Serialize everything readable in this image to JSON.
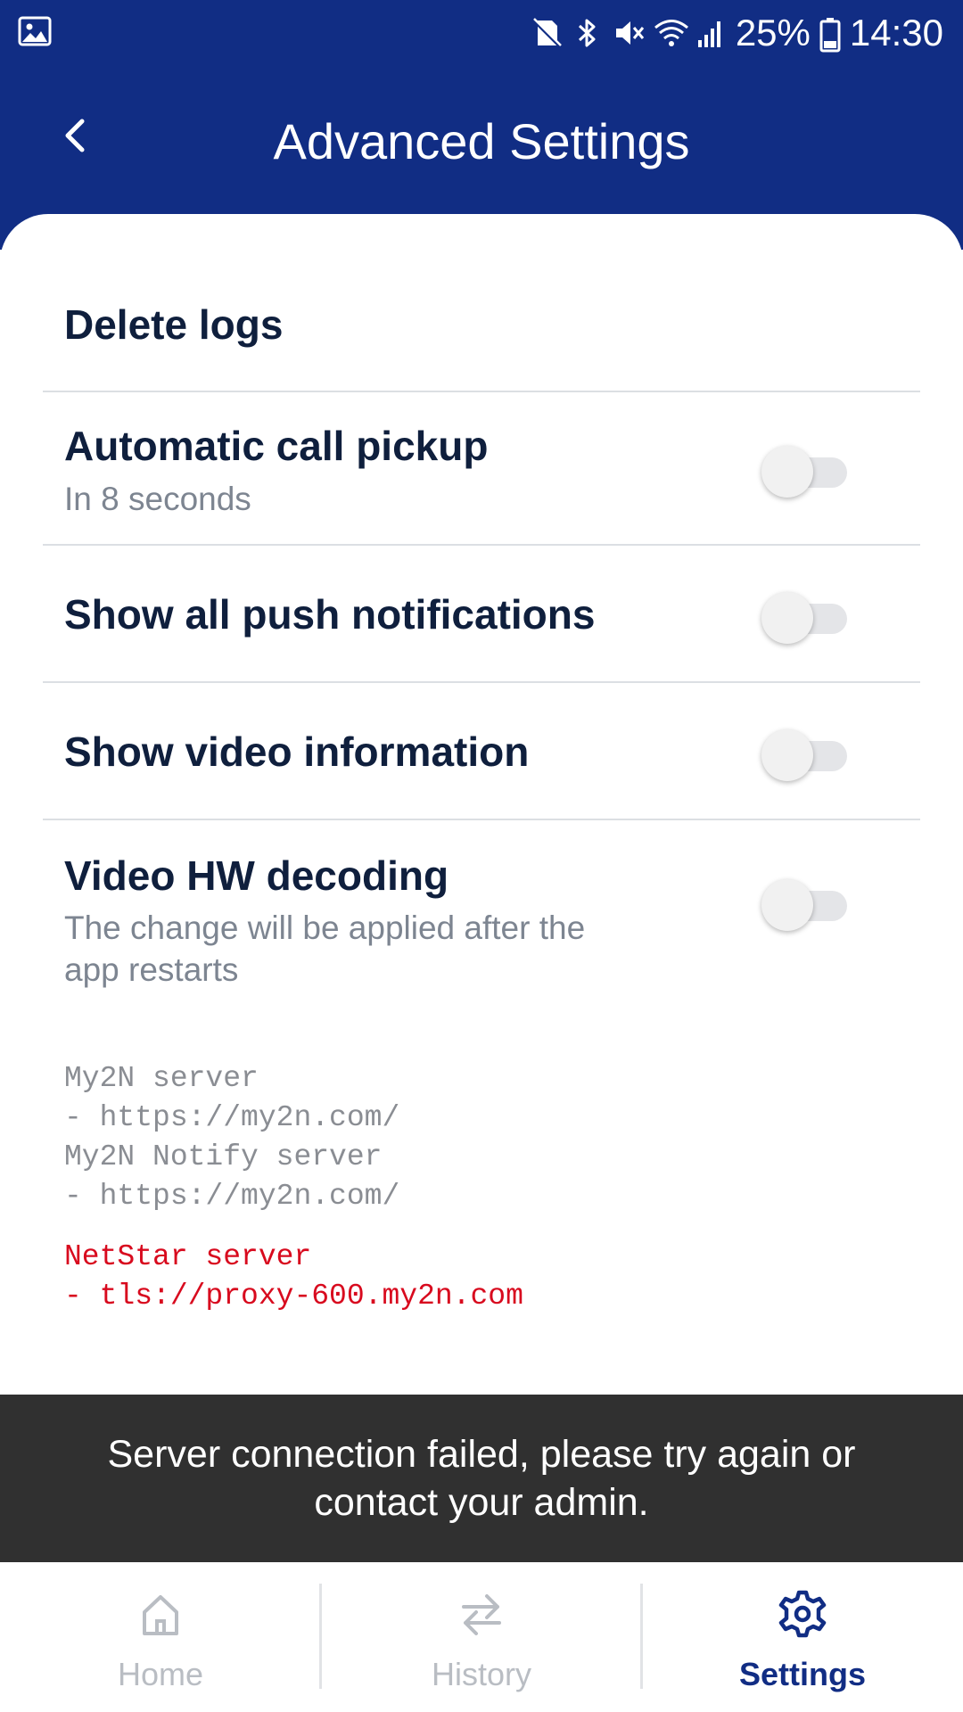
{
  "colors": {
    "header_bg": "#112d84",
    "title_text": "#0f1f3d",
    "subtitle_text": "#7d8591",
    "error_text": "#d80a1e",
    "snackbar_bg": "#303030",
    "nav_active": "#112d84",
    "nav_inactive": "#b9bdc3"
  },
  "status_bar": {
    "battery": "25%",
    "time": "14:30",
    "icons": [
      "gallery-icon",
      "no-sim-icon",
      "bluetooth-icon",
      "mute-icon",
      "wifi-icon",
      "signal-icon",
      "battery-icon"
    ]
  },
  "header": {
    "back_icon": "chevron-left-icon",
    "title": "Advanced Settings"
  },
  "settings": {
    "delete_logs": {
      "title": "Delete logs"
    },
    "auto_pickup": {
      "title": "Automatic call pickup",
      "subtitle": "In 8 seconds",
      "enabled": false
    },
    "push_notifications": {
      "title": "Show all push notifications",
      "enabled": false
    },
    "video_info": {
      "title": "Show video information",
      "enabled": false
    },
    "hw_decoding": {
      "title": "Video HW decoding",
      "subtitle_line1": "The change will be applied after the",
      "subtitle_line2": "app restarts",
      "enabled": false
    }
  },
  "servers": {
    "my2n_label": "My2N server",
    "my2n_url": "- https://my2n.com/",
    "notify_label": "My2N Notify server",
    "notify_url": "- https://my2n.com/",
    "netstar_label": "NetStar server",
    "netstar_url": "- tls://proxy-600.my2n.com"
  },
  "snackbar": {
    "line1": "Server connection failed, please try again or",
    "line2": "contact your admin."
  },
  "bottom_nav": {
    "items": [
      {
        "label": "Home",
        "icon": "home-icon",
        "active": false
      },
      {
        "label": "History",
        "icon": "swap-arrows-icon",
        "active": false
      },
      {
        "label": "Settings",
        "icon": "gear-icon",
        "active": true
      }
    ]
  }
}
